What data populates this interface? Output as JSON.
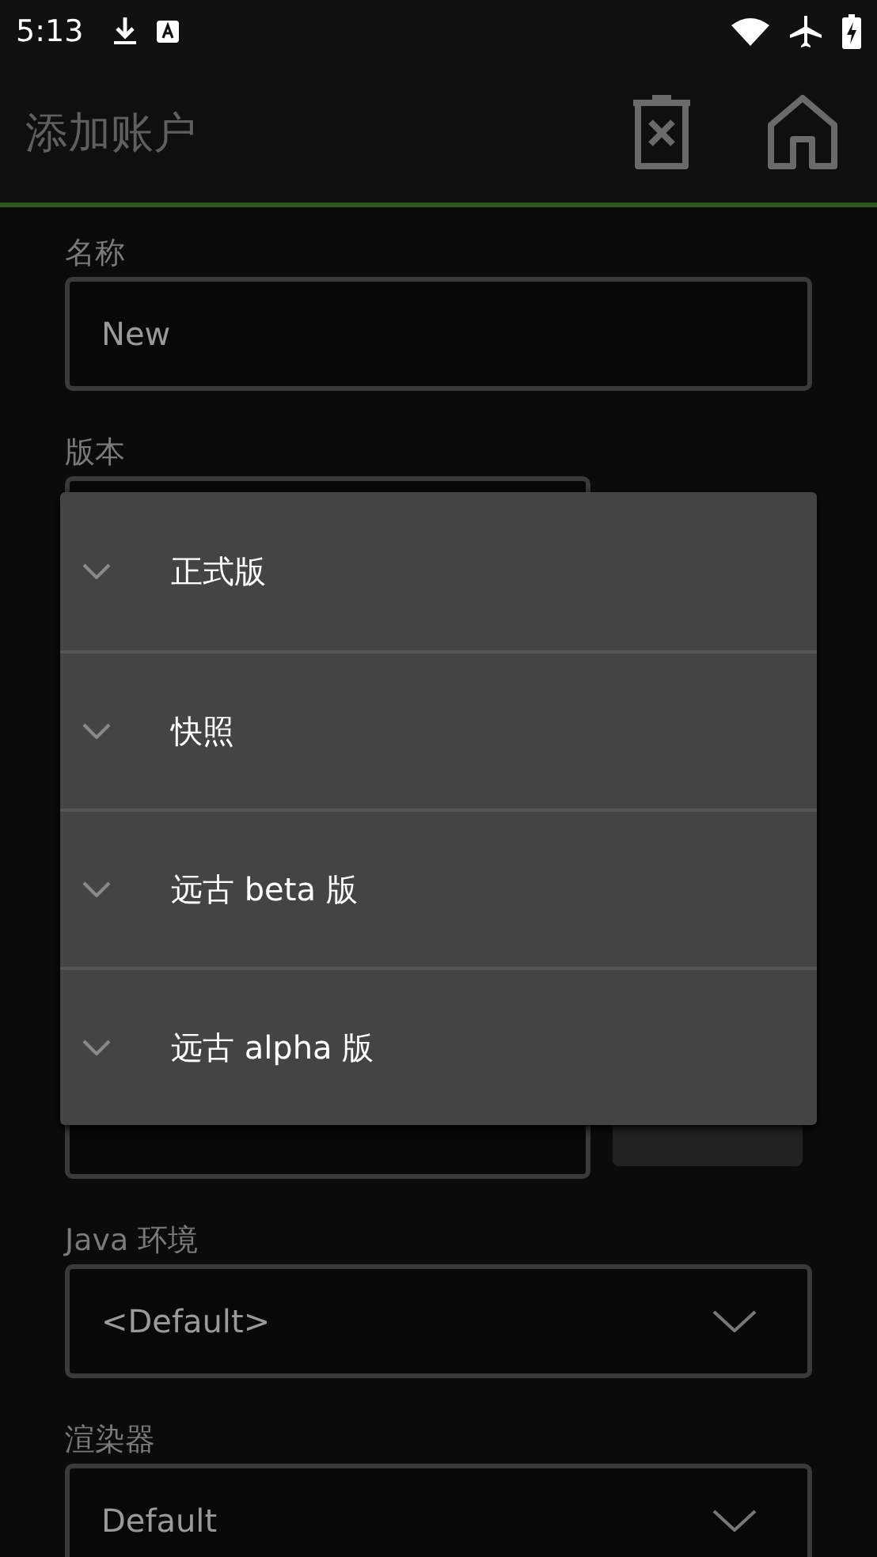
{
  "status_bar": {
    "time": "5:13"
  },
  "header": {
    "title": "添加账户"
  },
  "form": {
    "name": {
      "label": "名称",
      "value": "New"
    },
    "version": {
      "label": "版本"
    },
    "java": {
      "label": "Java 环境",
      "value": "<Default>"
    },
    "renderer": {
      "label": "渲染器",
      "value": "Default"
    }
  },
  "dropdown": {
    "items": [
      {
        "label": "正式版",
        "expanded": false
      },
      {
        "label": "快照",
        "expanded": false
      },
      {
        "label": "远古 beta 版",
        "expanded": false
      },
      {
        "label": "远古 alpha 版",
        "expanded": false
      }
    ]
  }
}
